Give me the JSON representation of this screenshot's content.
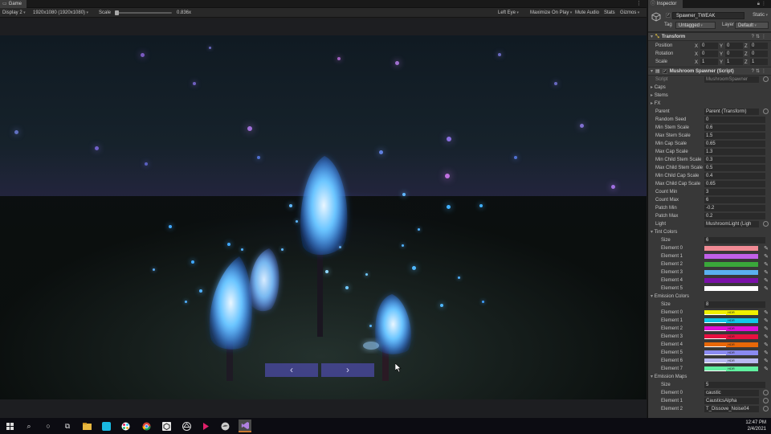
{
  "game": {
    "tab_label": "Game",
    "display": "Display 2",
    "resolution": "1920x1080 (1920x1080)",
    "scale_label": "Scale",
    "scale_value": "0.836x",
    "eye": "Left Eye",
    "maximize": "Maximize On Play",
    "mute": "Mute Audio",
    "stats": "Stats",
    "gizmos": "Gizmos",
    "nav_prev": "‹",
    "nav_next": "›"
  },
  "inspector": {
    "tab_label": "Inspector",
    "object_name": "Spawner_TWEAK",
    "static_label": "Static",
    "tag_label": "Tag",
    "tag_value": "Untagged",
    "layer_label": "Layer",
    "layer_value": "Default",
    "transform": {
      "title": "Transform",
      "rows": [
        {
          "label": "Position",
          "x": "0",
          "y": "0",
          "z": "0"
        },
        {
          "label": "Rotation",
          "x": "0",
          "y": "0",
          "z": "0"
        },
        {
          "label": "Scale",
          "x": "1",
          "y": "1",
          "z": "1"
        }
      ]
    },
    "script": {
      "title": "Mushroom Spawner (Script)",
      "script_label": "Script",
      "script_value": "MushroomSpawner",
      "foldouts": [
        "Caps",
        "Stems",
        "FX"
      ],
      "fields": [
        {
          "label": "Parent",
          "value": "Parent (Transform)",
          "picker": true
        },
        {
          "label": "Random Seed",
          "value": "0"
        },
        {
          "label": "Min Stem Scale",
          "value": "0.6"
        },
        {
          "label": "Max Stem Scale",
          "value": "1.5"
        },
        {
          "label": "Min Cap Scale",
          "value": "0.65"
        },
        {
          "label": "Max Cap Scale",
          "value": "1.3"
        },
        {
          "label": "Min Child Stem Scale",
          "value": "0.3"
        },
        {
          "label": "Max Child Stem Scale",
          "value": "0.5"
        },
        {
          "label": "Min Child Cap Scale",
          "value": "0.4"
        },
        {
          "label": "Max Child Cap Scale",
          "value": "0.65"
        },
        {
          "label": "Count Min",
          "value": "3"
        },
        {
          "label": "Count Max",
          "value": "6"
        },
        {
          "label": "Patch Min",
          "value": "-0.2"
        },
        {
          "label": "Patch Max",
          "value": "0.2"
        },
        {
          "label": "Light",
          "value": "MushroomLight (Ligh",
          "picker": true
        }
      ],
      "tint_colors": {
        "label": "Tint Colors",
        "size_label": "Size",
        "size": "6",
        "elements": [
          {
            "label": "Element 0",
            "color": "#f08a94"
          },
          {
            "label": "Element 1",
            "color": "#c060e8"
          },
          {
            "label": "Element 2",
            "color": "#3aa83a"
          },
          {
            "label": "Element 3",
            "color": "#5ab0f0"
          },
          {
            "label": "Element 4",
            "color": "#7a10a8"
          },
          {
            "label": "Element 5",
            "color": "#ffffff"
          }
        ]
      },
      "emission_colors": {
        "label": "Emission Colors",
        "size_label": "Size",
        "size": "8",
        "elements": [
          {
            "label": "Element 0",
            "color": "#f0f000",
            "tag": "HDR"
          },
          {
            "label": "Element 1",
            "color": "#10c8e8",
            "tag": "HDR"
          },
          {
            "label": "Element 2",
            "color": "#e010d8",
            "tag": "HDR"
          },
          {
            "label": "Element 3",
            "color": "#e81040",
            "tag": "HDR"
          },
          {
            "label": "Element 4",
            "color": "#e86808",
            "tag": "HDR"
          },
          {
            "label": "Element 5",
            "color": "#8a8af0",
            "tag": "HDR"
          },
          {
            "label": "Element 6",
            "color": "#b8b8f0",
            "tag": "HDR"
          },
          {
            "label": "Element 7",
            "color": "#60f0a0",
            "tag": "HDR"
          }
        ]
      },
      "emission_maps": {
        "label": "Emission Maps",
        "size_label": "Size",
        "size": "5",
        "elements": [
          {
            "label": "Element 0",
            "value": "caustic"
          },
          {
            "label": "Element 1",
            "value": "CausticsAlpha"
          },
          {
            "label": "Element 2",
            "value": "T_Dissove_Noise04"
          }
        ]
      }
    }
  },
  "taskbar": {
    "time": "12:47 PM",
    "date": "2/4/2021"
  }
}
